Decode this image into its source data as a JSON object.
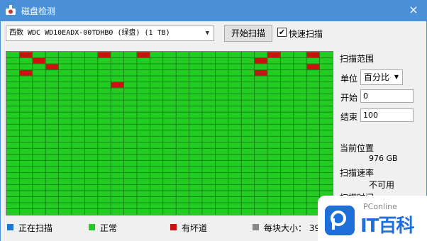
{
  "window": {
    "title": "磁盘检测",
    "close_glyph": "×"
  },
  "toolbar": {
    "disk_value": "西数 WDC WD10EADX-00TDHB0 (绿盘)  (1 TB)",
    "start_label": "开始扫描",
    "quick_scan_checked": true,
    "quick_scan_label": "快速扫描"
  },
  "panel": {
    "range_label": "扫描范围",
    "unit_label": "单位",
    "unit_value": "百分比",
    "start_label": "开始",
    "start_value": "0",
    "end_label": "结束",
    "end_value": "100",
    "position_label": "当前位置",
    "position_value": "976 GB",
    "speed_label": "扫描速率",
    "speed_value": "不可用",
    "time_label": "扫描时间"
  },
  "legend": {
    "scanning": "正在扫描",
    "normal": "正常",
    "bad": "有坏道",
    "block_size": "每块大小：  390"
  },
  "block_map": {
    "columns": 25,
    "rows": 27,
    "bad_blocks": [
      [
        1,
        0
      ],
      [
        7,
        0
      ],
      [
        10,
        0
      ],
      [
        20,
        0
      ],
      [
        23,
        0
      ],
      [
        2,
        1
      ],
      [
        19,
        1
      ],
      [
        3,
        2
      ],
      [
        23,
        2
      ],
      [
        1,
        3
      ],
      [
        19,
        3
      ],
      [
        8,
        5
      ]
    ]
  },
  "colors": {
    "titlebar": "#4a90d9",
    "normal": "#22cc22",
    "bad": "#cc1111",
    "scanning": "#1e78d2",
    "size_marker": "#888888",
    "grid_line": "#0f7a0f"
  },
  "watermark": {
    "brand": "PConline",
    "text": "IT百科"
  }
}
